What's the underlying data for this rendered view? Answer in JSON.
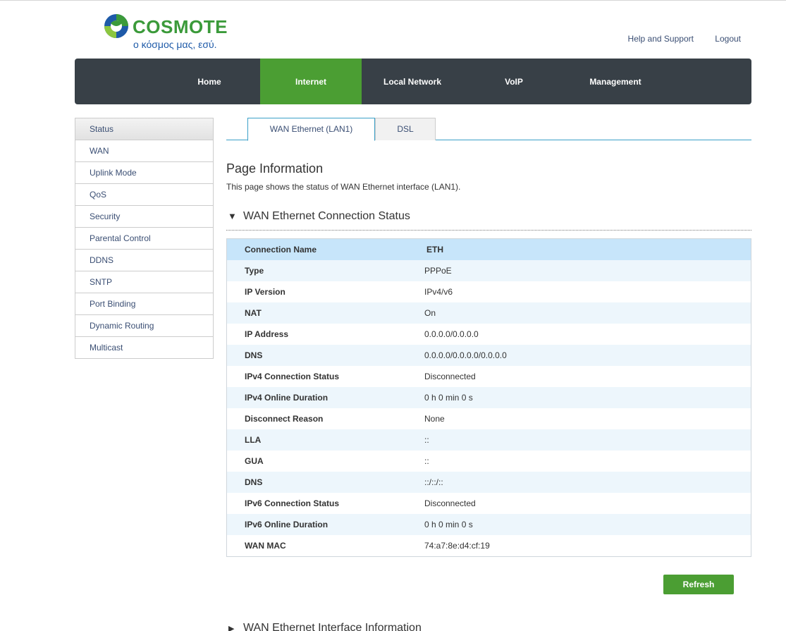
{
  "brand": {
    "name": "COSMOTE",
    "tagline": "ο κόσμος μας, εσύ.",
    "color_green": "#3b9a3a",
    "color_blue": "#1e5aa8"
  },
  "top_links": {
    "help": "Help and Support",
    "logout": "Logout"
  },
  "nav": {
    "items": [
      {
        "label": "Home"
      },
      {
        "label": "Internet"
      },
      {
        "label": "Local Network"
      },
      {
        "label": "VoIP"
      },
      {
        "label": "Management"
      }
    ],
    "active": "Internet",
    "active_color": "#4b9e33",
    "bar_color": "#384047"
  },
  "sidebar": {
    "items": [
      {
        "label": "Status"
      },
      {
        "label": "WAN"
      },
      {
        "label": "Uplink Mode"
      },
      {
        "label": "QoS"
      },
      {
        "label": "Security"
      },
      {
        "label": "Parental Control"
      },
      {
        "label": "DDNS"
      },
      {
        "label": "SNTP"
      },
      {
        "label": "Port Binding"
      },
      {
        "label": "Dynamic Routing"
      },
      {
        "label": "Multicast"
      }
    ],
    "active": "Status"
  },
  "tabs": {
    "wan": "WAN Ethernet (LAN1)",
    "dsl": "DSL",
    "active": "WAN Ethernet (LAN1)"
  },
  "page": {
    "title": "Page Information",
    "description": "This page shows the status of WAN Ethernet interface (LAN1)."
  },
  "section1": {
    "title": "WAN Ethernet Connection Status",
    "expanded_icon": "▼",
    "rows": [
      {
        "label": "Connection Name",
        "value": "ETH"
      },
      {
        "label": "Type",
        "value": "PPPoE"
      },
      {
        "label": "IP Version",
        "value": "IPv4/v6"
      },
      {
        "label": "NAT",
        "value": "On"
      },
      {
        "label": "IP Address",
        "value": "0.0.0.0/0.0.0.0"
      },
      {
        "label": "DNS",
        "value": "0.0.0.0/0.0.0.0/0.0.0.0"
      },
      {
        "label": "IPv4 Connection Status",
        "value": "Disconnected"
      },
      {
        "label": "IPv4 Online Duration",
        "value": "0 h 0 min 0 s"
      },
      {
        "label": "Disconnect Reason",
        "value": "None"
      },
      {
        "label": "LLA",
        "value": "::"
      },
      {
        "label": "GUA",
        "value": "::"
      },
      {
        "label": "DNS",
        "value": "::/::/::"
      },
      {
        "label": "IPv6 Connection Status",
        "value": "Disconnected"
      },
      {
        "label": "IPv6 Online Duration",
        "value": "0 h 0 min 0 s"
      },
      {
        "label": "WAN MAC",
        "value": "74:a7:8e:d4:cf:19"
      }
    ]
  },
  "refresh_label": "Refresh",
  "section2": {
    "title": "WAN Ethernet Interface Information",
    "collapsed_icon": "▶"
  }
}
